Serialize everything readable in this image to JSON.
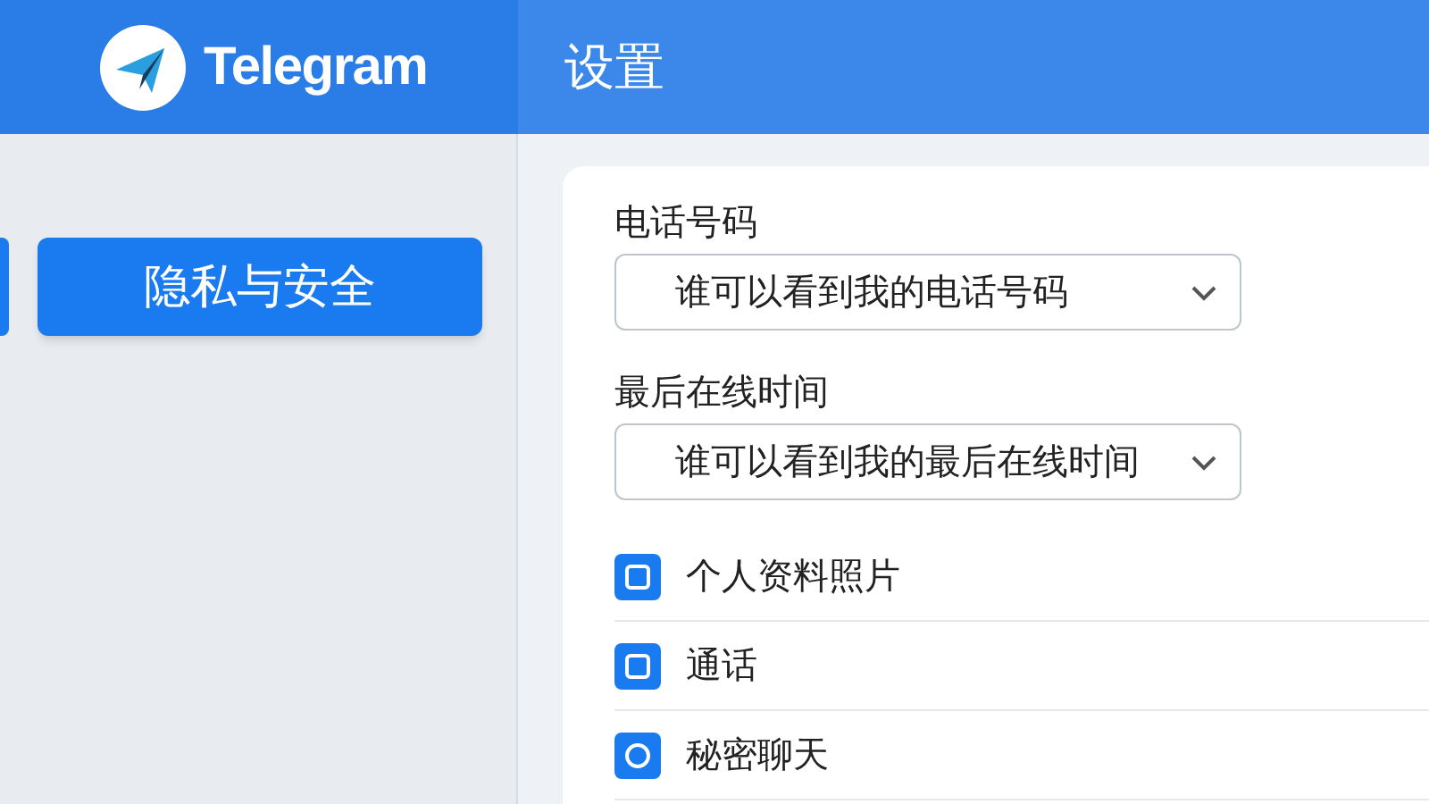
{
  "app": {
    "name": "Telegram"
  },
  "header": {
    "title": "设置"
  },
  "sidebar": {
    "items": [
      {
        "label": "隐私与安全",
        "selected": true
      }
    ]
  },
  "fields": [
    {
      "label": "电话号码",
      "value": "谁可以看到我的电话号码"
    },
    {
      "label": "最后在线时间",
      "value": "谁可以看到我的最后在线时间"
    }
  ],
  "options": [
    {
      "label": "个人资料照片",
      "kind": "square"
    },
    {
      "label": "通话",
      "kind": "square"
    },
    {
      "label": "秘密聊天",
      "kind": "circle"
    }
  ]
}
